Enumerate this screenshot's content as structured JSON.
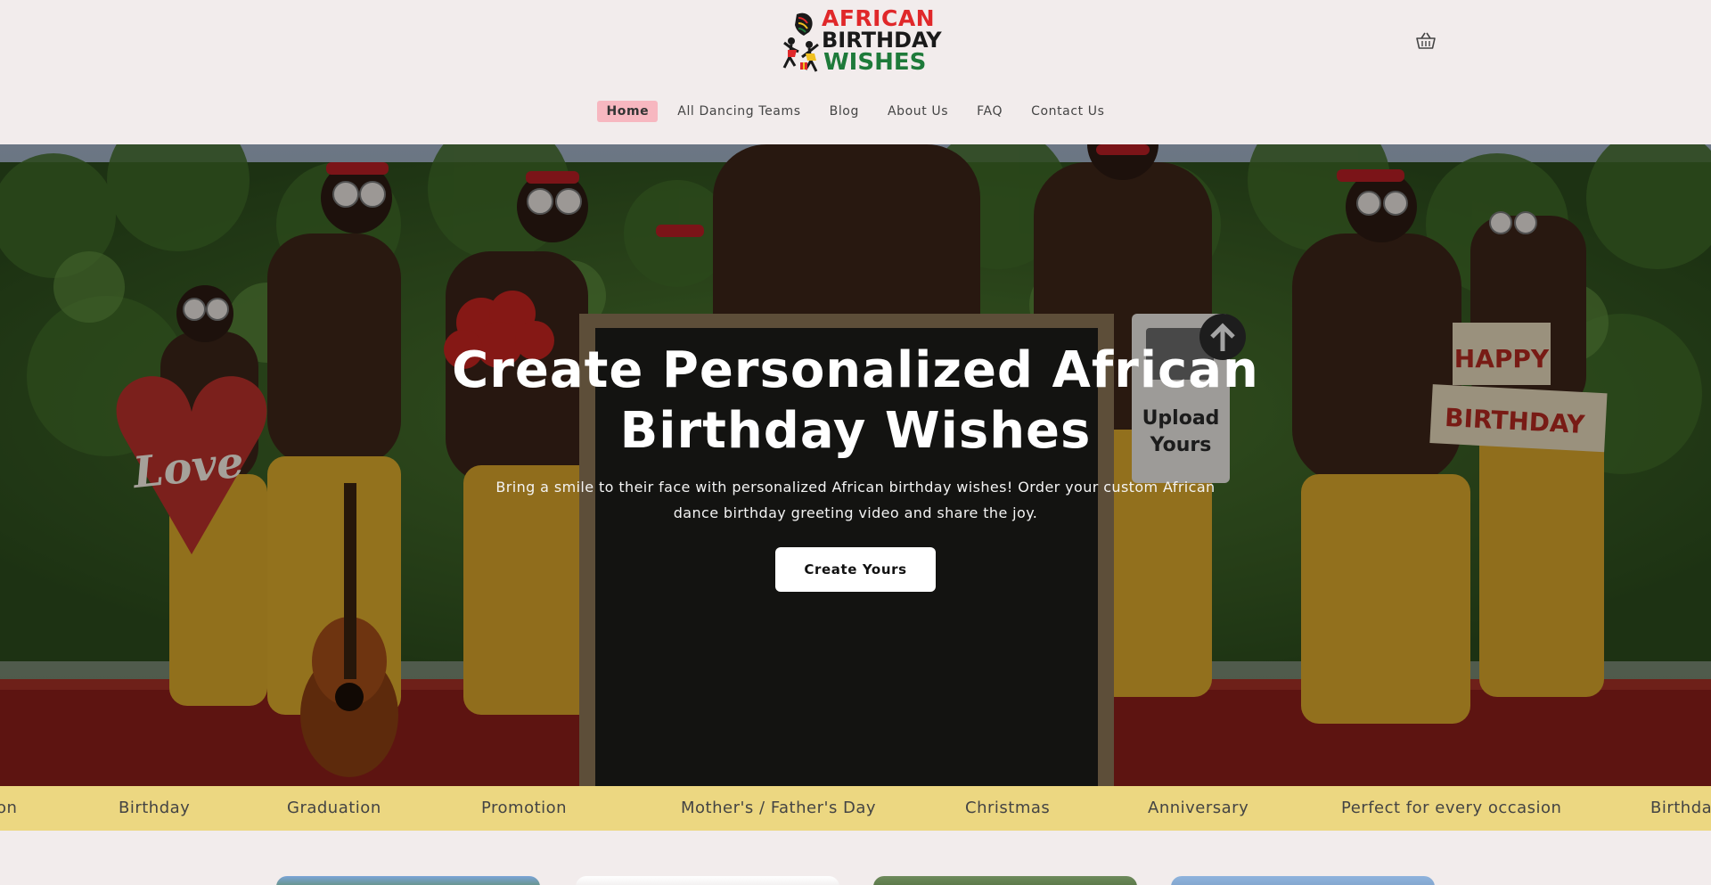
{
  "header": {
    "logo": {
      "line1": "AFRICAN",
      "line2": "BIRTHDAY",
      "line3": "WISHES",
      "colors": {
        "red": "#e0282a",
        "black": "#1a1a1a",
        "green": "#1e7a3a"
      }
    },
    "cart_icon": "cart-icon"
  },
  "nav": {
    "items": [
      {
        "label": "Home",
        "active": true
      },
      {
        "label": "All Dancing Teams"
      },
      {
        "label": "Blog"
      },
      {
        "label": "About Us"
      },
      {
        "label": "FAQ"
      },
      {
        "label": "Contact Us"
      }
    ],
    "active_color": "#f7b7c0"
  },
  "hero": {
    "title": "Create Personalized African Birthday Wishes",
    "subtitle": "Bring a smile to their face with personalized African birthday wishes! Order your custom African dance birthday greeting video and share the joy.",
    "cta_label": "Create Yours",
    "image_signs": {
      "heart": "Love",
      "upload": "Upload Yours",
      "banner_top": "HAPPY",
      "banner_bottom": "BIRTHDAY"
    }
  },
  "strip": {
    "background": "#ecd781",
    "items": [
      "on",
      "Birthday",
      "Graduation",
      "Promotion",
      "Mother's / Father's Day",
      "Christmas",
      "Anniversary",
      "Perfect for every occasion",
      "Birthday"
    ]
  }
}
